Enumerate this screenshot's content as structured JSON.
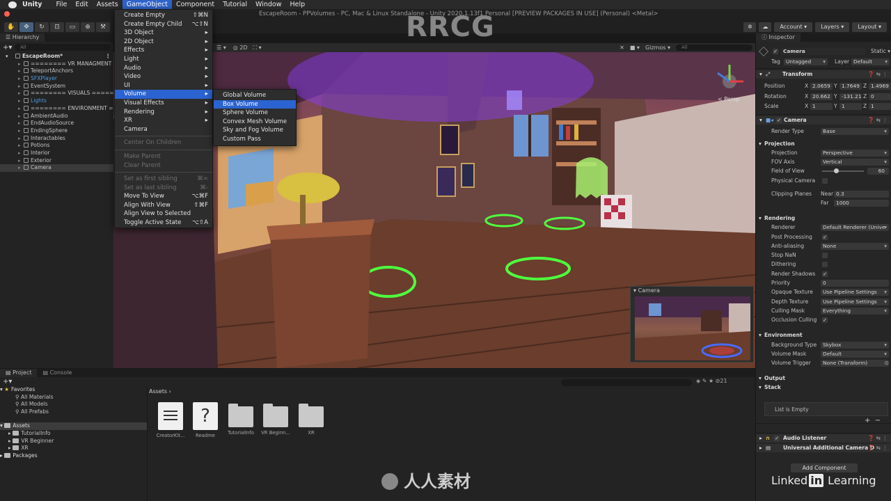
{
  "mac_menu": {
    "app": "Unity",
    "items": [
      "File",
      "Edit",
      "Assets",
      "GameObject",
      "Component",
      "Tutorial",
      "Window",
      "Help"
    ],
    "active": "GameObject"
  },
  "window_title": "EscapeRoom - PPVolumes - PC, Mac & Linux Standalone - Unity 2020.1.13f1 Personal [PREVIEW PACKAGES IN USE] (Personal) <Metal>",
  "toolbar": {
    "account": "Account",
    "layers": "Layers",
    "layout": "Layout"
  },
  "hierarchy": {
    "tab": "Hierarchy",
    "search_placeholder": "All",
    "rows": [
      {
        "label": "EscapeRoom*",
        "type": "root"
      },
      {
        "label": "======== VR MANAGMENT ====",
        "type": "normal"
      },
      {
        "label": "TeleportAnchors",
        "type": "normal"
      },
      {
        "label": "SFXPlayer",
        "type": "blue"
      },
      {
        "label": "EventSystem",
        "type": "normal"
      },
      {
        "label": "======== VISUALS ========",
        "type": "normal"
      },
      {
        "label": "Lights",
        "type": "blue"
      },
      {
        "label": "======== ENVIRONMENT ====",
        "type": "normal"
      },
      {
        "label": "AmbientAudio",
        "type": "normal"
      },
      {
        "label": "EndAudioSource",
        "type": "normal"
      },
      {
        "label": "EndingSphere",
        "type": "normal"
      },
      {
        "label": "Interactables",
        "type": "normal"
      },
      {
        "label": "Potions",
        "type": "normal"
      },
      {
        "label": "Interior",
        "type": "normal"
      },
      {
        "label": "Exterior",
        "type": "normal"
      },
      {
        "label": "Camera",
        "type": "sel"
      }
    ]
  },
  "gameobject_menu": {
    "items": [
      {
        "label": "Create Empty",
        "shortcut": "⇧⌘N",
        "state": "normal"
      },
      {
        "label": "Create Empty Child",
        "shortcut": "⌥⇧N",
        "state": "normal"
      },
      {
        "label": "3D Object",
        "shortcut": "▸",
        "state": "normal"
      },
      {
        "label": "2D Object",
        "shortcut": "▸",
        "state": "normal"
      },
      {
        "label": "Effects",
        "shortcut": "▸",
        "state": "normal"
      },
      {
        "label": "Light",
        "shortcut": "▸",
        "state": "normal"
      },
      {
        "label": "Audio",
        "shortcut": "▸",
        "state": "normal"
      },
      {
        "label": "Video",
        "shortcut": "▸",
        "state": "normal"
      },
      {
        "label": "UI",
        "shortcut": "▸",
        "state": "normal"
      },
      {
        "label": "Volume",
        "shortcut": "▸",
        "state": "hl"
      },
      {
        "label": "Visual Effects",
        "shortcut": "▸",
        "state": "normal"
      },
      {
        "label": "Rendering",
        "shortcut": "▸",
        "state": "normal"
      },
      {
        "label": "XR",
        "shortcut": "▸",
        "state": "normal"
      },
      {
        "label": "Camera",
        "shortcut": "",
        "state": "normal"
      },
      {
        "sep": true
      },
      {
        "label": "Center On Children",
        "shortcut": "",
        "state": "dis"
      },
      {
        "sep": true
      },
      {
        "label": "Make Parent",
        "shortcut": "",
        "state": "dis"
      },
      {
        "label": "Clear Parent",
        "shortcut": "",
        "state": "dis"
      },
      {
        "sep": true
      },
      {
        "label": "Set as first sibling",
        "shortcut": "⌘=",
        "state": "dis"
      },
      {
        "label": "Set as last sibling",
        "shortcut": "⌘-",
        "state": "dis"
      },
      {
        "label": "Move To View",
        "shortcut": "⌥⌘F",
        "state": "normal"
      },
      {
        "label": "Align With View",
        "shortcut": "⇧⌘F",
        "state": "normal"
      },
      {
        "label": "Align View to Selected",
        "shortcut": "",
        "state": "normal"
      },
      {
        "label": "Toggle Active State",
        "shortcut": "⌥⇧A",
        "state": "normal"
      }
    ]
  },
  "volume_submenu": {
    "items": [
      {
        "label": "Global Volume",
        "state": "normal"
      },
      {
        "label": "Box Volume",
        "state": "hl"
      },
      {
        "label": "Sphere Volume",
        "state": "normal"
      },
      {
        "label": "Convex Mesh Volume",
        "state": "normal"
      },
      {
        "label": "Sky and Fog Volume",
        "state": "normal"
      },
      {
        "label": "Custom Pass",
        "state": "normal"
      }
    ]
  },
  "scene": {
    "gizmos": "Gizmos",
    "search_placeholder": "All",
    "persp_label": "< Persp",
    "camera_preview_title": "Camera"
  },
  "project": {
    "tabs": [
      "Project",
      "Console"
    ],
    "favorites_title": "Favorites",
    "favorites": [
      "All Materials",
      "All Models",
      "All Prefabs"
    ],
    "assets_title": "Assets",
    "asset_tree": [
      "TutorialInfo",
      "VR Beginner",
      "XR"
    ],
    "packages": "Packages",
    "breadcrumb": "Assets",
    "items": [
      {
        "name": "CreatorKit...",
        "kind": "doc"
      },
      {
        "name": "Readme",
        "kind": "readme"
      },
      {
        "name": "TutorialInfo",
        "kind": "folder"
      },
      {
        "name": "VR Beginn...",
        "kind": "folder"
      },
      {
        "name": "XR",
        "kind": "folder"
      }
    ],
    "count": "21"
  },
  "inspector": {
    "tab": "Inspector",
    "object_name": "Camera",
    "static": "Static",
    "tag_label": "Tag",
    "tag": "Untagged",
    "layer_label": "Layer",
    "layer": "Default",
    "transform": {
      "title": "Transform",
      "position": {
        "label": "Position",
        "x": "2.0659",
        "y": "1.7649",
        "z": "1.4969"
      },
      "rotation": {
        "label": "Rotation",
        "x": "20.662",
        "y": "-131.21",
        "z": "0"
      },
      "scale": {
        "label": "Scale",
        "x": "1",
        "y": "1",
        "z": "1"
      }
    },
    "camera": {
      "title": "Camera",
      "render_type_label": "Render Type",
      "render_type": "Base",
      "projection_title": "Projection",
      "projection_label": "Projection",
      "projection": "Perspective",
      "fov_axis_label": "FOV Axis",
      "fov_axis": "Vertical",
      "fov_label": "Field of View",
      "fov": "60",
      "fov_fraction": 0.33,
      "physical_label": "Physical Camera",
      "clipping_label": "Clipping Planes",
      "near_label": "Near",
      "near": "0.3",
      "far_label": "Far",
      "far": "1000",
      "rendering_title": "Rendering",
      "renderer_label": "Renderer",
      "renderer": "Default Renderer (Unive",
      "post_label": "Post Processing",
      "aa_label": "Anti-aliasing",
      "aa": "None",
      "stopnan_label": "Stop NaN",
      "dither_label": "Dithering",
      "shadows_label": "Render Shadows",
      "priority_label": "Priority",
      "priority": "0",
      "opaque_label": "Opaque Texture",
      "opaque": "Use Pipeline Settings",
      "depth_label": "Depth Texture",
      "depth": "Use Pipeline Settings",
      "culling_label": "Culling Mask",
      "culling": "Everything",
      "occlusion_label": "Occlusion Culling",
      "environment_title": "Environment",
      "bgtype_label": "Background Type",
      "bgtype": "Skybox",
      "volmask_label": "Volume Mask",
      "volmask": "Default",
      "voltrig_label": "Volume Trigger",
      "voltrig": "None (Transform)",
      "output_title": "Output",
      "stack_title": "Stack",
      "list_empty": "List is Empty"
    },
    "audio_listener": "Audio Listener",
    "additional_camera": "Universal Additional Camera D",
    "add_component": "Add Component"
  },
  "watermarks": {
    "rrcg": "RRCG",
    "linkedin_a": "Linked",
    "linkedin_b": "in",
    "linkedin_c": "Learning",
    "bottom": "人人素材"
  }
}
